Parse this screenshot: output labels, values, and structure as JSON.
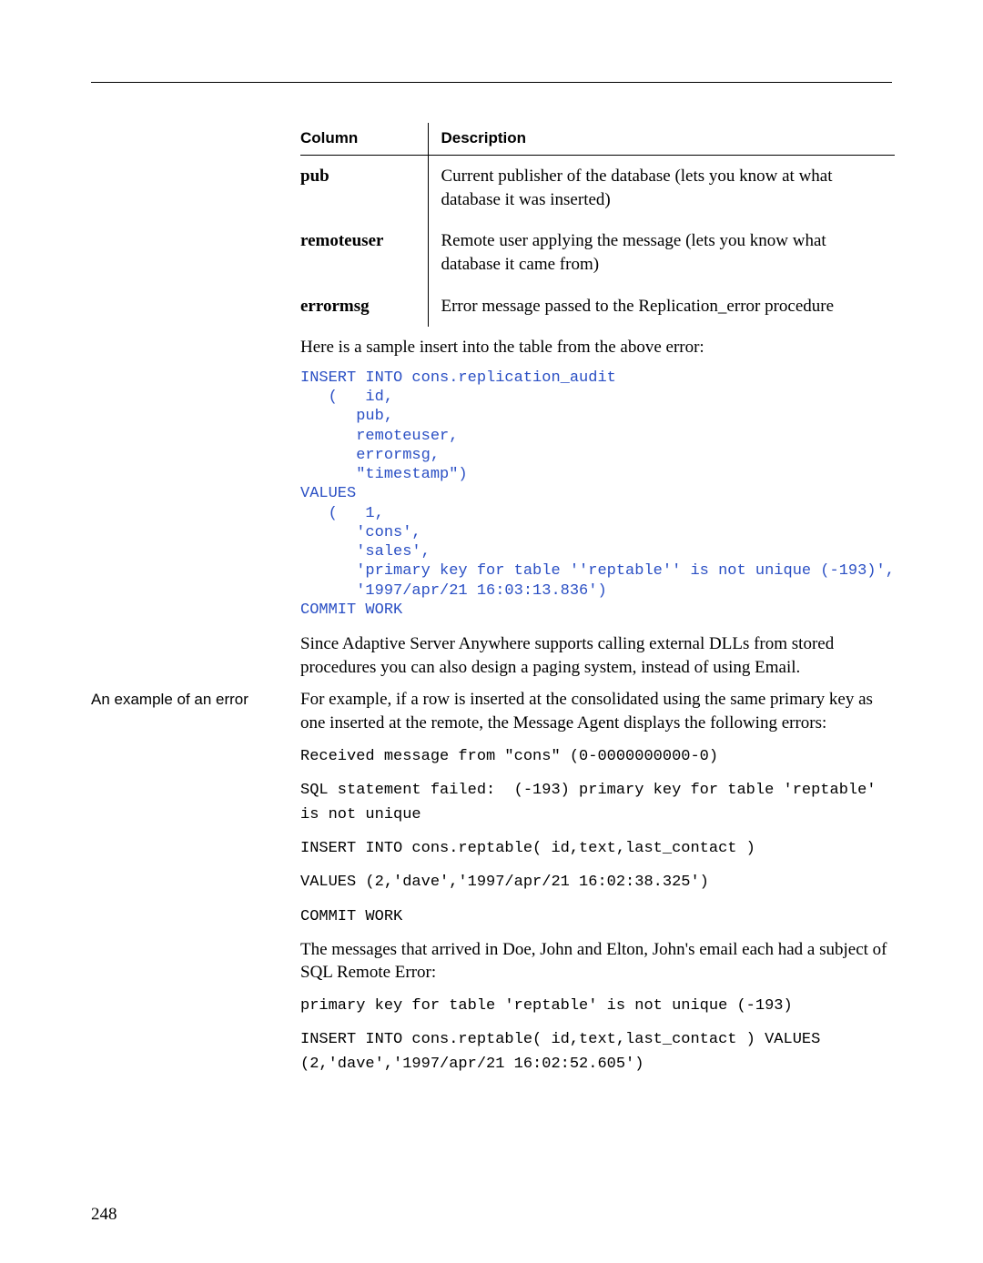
{
  "table": {
    "headers": {
      "col": "Column",
      "desc": "Description"
    },
    "rows": [
      {
        "col": "pub",
        "desc": "Current publisher of the database (lets you know at what database it was inserted)"
      },
      {
        "col": "remoteuser",
        "desc": "Remote user applying the message (lets you know what database it came from)"
      },
      {
        "col": "errormsg",
        "desc": "Error message passed to the Replication_error procedure"
      }
    ]
  },
  "para": {
    "sample_intro": "Here is a sample insert into the table from the above error:",
    "dll_note": "Since Adaptive Server Anywhere supports calling external DLLs from stored procedures you can also design a paging system, instead of using Email.",
    "example_intro": "For example, if a row is inserted at the consolidated using the same primary key as one inserted at the remote, the Message Agent displays the following errors:",
    "email_note": "The messages that arrived in Doe, John and Elton, John's email each had a subject of SQL Remote Error:"
  },
  "code": {
    "insert_block": "INSERT INTO cons.replication_audit\n   (   id,\n      pub,\n      remoteuser,\n      errormsg,\n      \"timestamp\")\nVALUES\n   (   1,\n      'cons',\n      'sales',\n      'primary key for table ''reptable'' is not unique (-193)',\n      '1997/apr/21 16:03:13.836')\nCOMMIT WORK",
    "recv": "Received message from \"cons\" (0-0000000000-0)",
    "sqlfail": "SQL statement failed:  (-193) primary key for table 'reptable' is not unique",
    "insert2": "INSERT INTO cons.reptable( id,text,last_contact )",
    "values2": "VALUES (2,'dave','1997/apr/21 16:02:38.325')",
    "commit2": "COMMIT WORK",
    "pk_msg": "primary key for table 'reptable' is not unique (-193)",
    "insert3": "INSERT INTO cons.reptable( id,text,last_contact ) VALUES (2,'dave','1997/apr/21 16:02:52.605')"
  },
  "sidebar": {
    "example_heading": "An example of an error"
  },
  "page_number": "248"
}
